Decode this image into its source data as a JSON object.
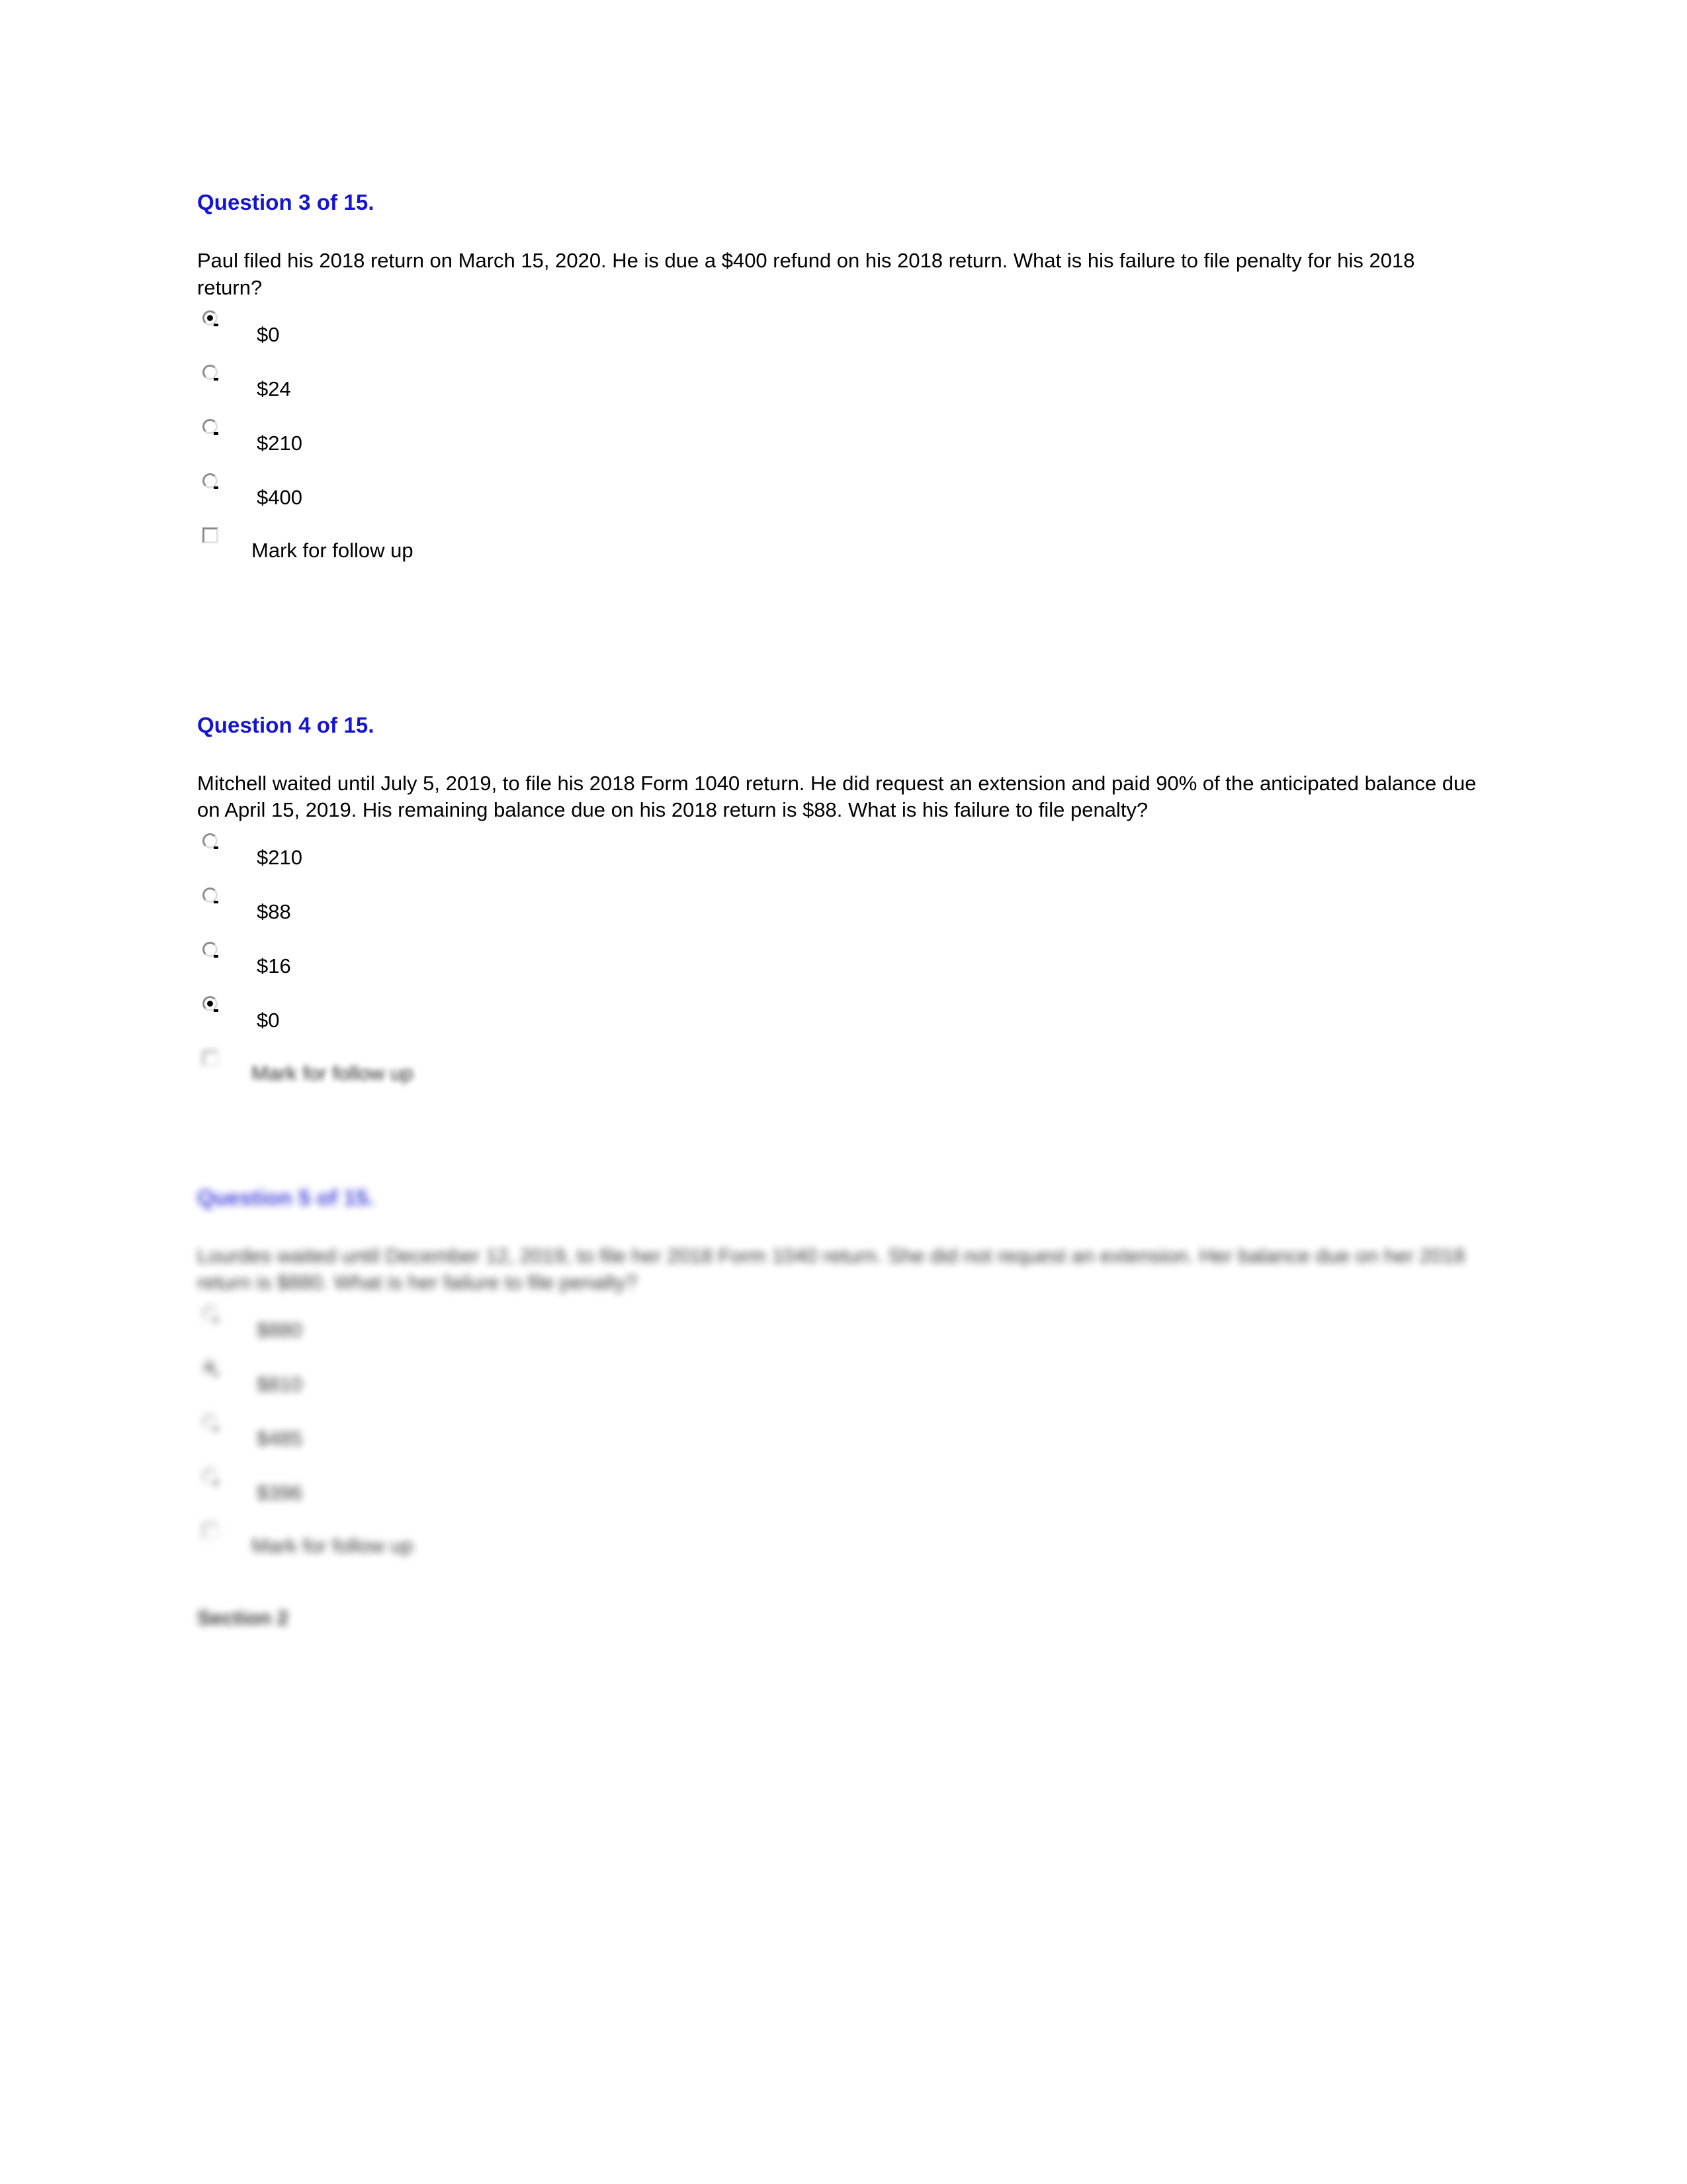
{
  "document": {
    "background_color": "#ffffff",
    "heading_color": "#1414d2",
    "body_text_color": "#000000"
  },
  "questions": [
    {
      "heading": "Question 3 of 15.",
      "body": "Paul filed his 2018 return on March 15, 2020. He is due a $400 refund on his 2018 return. What is his failure to file penalty for his 2018 return?",
      "options": [
        {
          "label": "$0",
          "selected": true
        },
        {
          "label": "$24",
          "selected": false
        },
        {
          "label": "$210",
          "selected": false
        },
        {
          "label": "$400",
          "selected": false
        }
      ],
      "followup": {
        "label": "Mark for follow up",
        "checked": false
      },
      "blurred": false
    },
    {
      "heading": "Question 4 of 15.",
      "body": "Mitchell waited until July 5, 2019, to file his 2018 Form 1040 return. He did request an extension and paid 90% of the anticipated balance due on April 15, 2019. His remaining balance due on his 2018 return is $88. What is his failure to file penalty?",
      "options": [
        {
          "label": "$210",
          "selected": false
        },
        {
          "label": "$88",
          "selected": false
        },
        {
          "label": "$16",
          "selected": false
        },
        {
          "label": "$0",
          "selected": true
        }
      ],
      "followup": {
        "label": "Mark for follow up",
        "checked": false
      },
      "blurred": false
    },
    {
      "heading": "Question 5 of 15.",
      "body": "Lourdes waited until December 12, 2019, to file her 2018 Form 1040 return. She did not request an extension. Her balance due on her 2018 return is $880. What is her failure to file penalty?",
      "options": [
        {
          "label": "$880",
          "selected": false
        },
        {
          "label": "$810",
          "selected": true
        },
        {
          "label": "$485",
          "selected": false
        },
        {
          "label": "$396",
          "selected": false
        }
      ],
      "followup": {
        "label": "Mark for follow up",
        "checked": false
      },
      "blurred": true
    }
  ],
  "footer": {
    "section_heading": "Section 2"
  }
}
